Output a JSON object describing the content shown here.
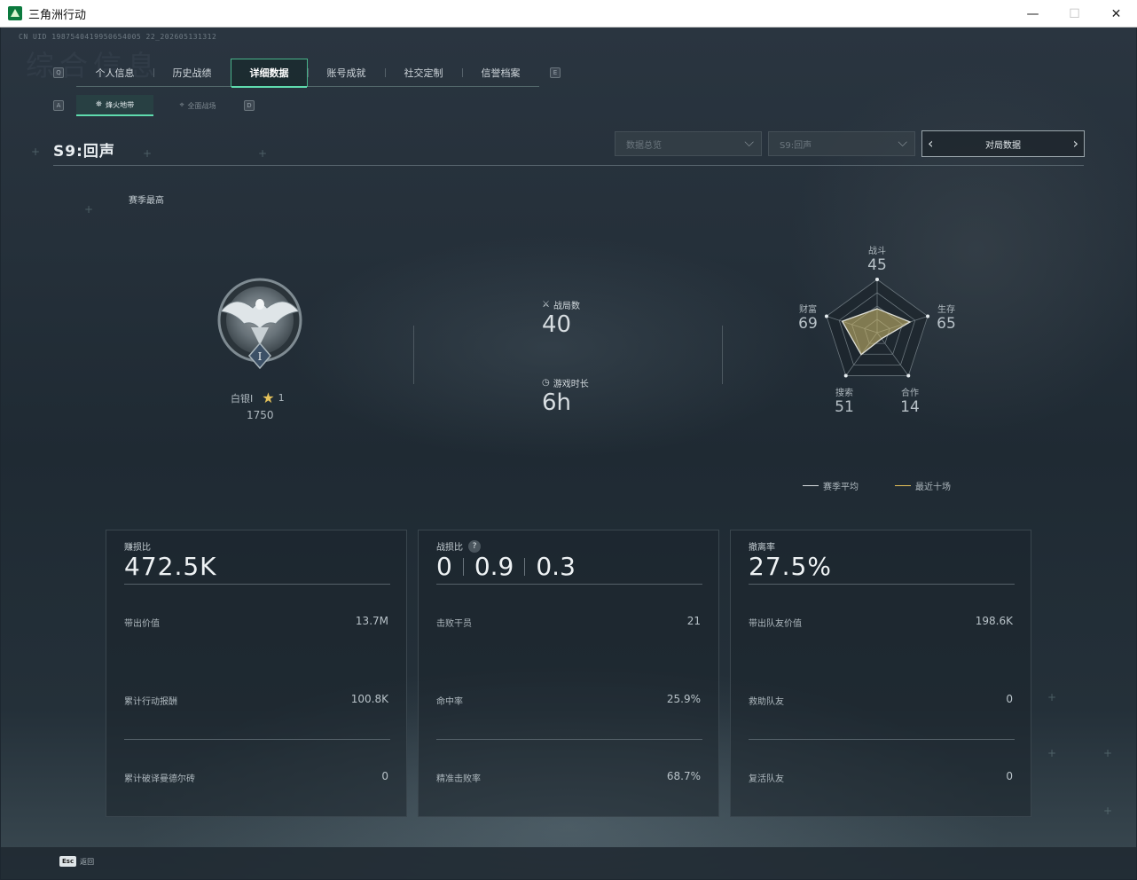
{
  "window": {
    "title": "三角洲行动",
    "minimize": "—",
    "maximize": "☐",
    "close": "✕"
  },
  "uid": "CN UID 1987540419950654005 22_202605131312",
  "watermark": "综合信息",
  "key_hints": {
    "prev_tab": "Q",
    "next_tab": "E",
    "prev_sub": "A",
    "next_sub": "D"
  },
  "main_tabs": [
    {
      "label": "个人信息",
      "active": false
    },
    {
      "label": "历史战绩",
      "active": false
    },
    {
      "label": "详细数据",
      "active": true
    },
    {
      "label": "账号成就",
      "active": false
    },
    {
      "label": "社交定制",
      "active": false
    },
    {
      "label": "信誉档案",
      "active": false
    }
  ],
  "sub_tabs": [
    {
      "label": "烽火地带",
      "icon": "tower-icon",
      "active": true
    },
    {
      "label": "全面战场",
      "icon": "crosshair-icon",
      "active": false
    }
  ],
  "season_title": "S9:回声",
  "filters": {
    "data_type": "数据总览",
    "season": "S9:回声",
    "match_data": "对局数据"
  },
  "season_high": "赛季最高",
  "rank": {
    "name": "白银I",
    "stars": "1",
    "score": "1750",
    "roman": "I"
  },
  "stats": {
    "matches_label": "战局数",
    "matches_value": "40",
    "playtime_label": "游戏时长",
    "playtime_value": "6h"
  },
  "radar": {
    "combat_label": "战斗",
    "combat_value": "45",
    "survival_label": "生存",
    "survival_value": "65",
    "coop_label": "合作",
    "coop_value": "14",
    "search_label": "搜索",
    "search_value": "51",
    "wealth_label": "财富",
    "wealth_value": "69",
    "season_avg": [
      45,
      65,
      14,
      51,
      69
    ],
    "recent_ten": [
      45,
      65,
      14,
      51,
      69
    ]
  },
  "legend": {
    "season_avg": "赛季平均",
    "recent_ten": "最近十场"
  },
  "colors": {
    "accent": "#5fdcae",
    "recent": "#e6c35a",
    "avg": "#d8dde0"
  },
  "cards": {
    "profit": {
      "title": "赚损比",
      "value": "472.5K",
      "rows": [
        {
          "label": "带出价值",
          "value": "13.7M"
        },
        {
          "label": "累计行动报酬",
          "value": "100.8K"
        },
        {
          "label": "累计破译曼德尔砖",
          "value": "0"
        }
      ]
    },
    "combat": {
      "title": "战损比",
      "help": "?",
      "values": [
        "0",
        "0.9",
        "0.3"
      ],
      "rows": [
        {
          "label": "击败干员",
          "value": "21"
        },
        {
          "label": "命中率",
          "value": "25.9%"
        },
        {
          "label": "精准击败率",
          "value": "68.7%"
        }
      ]
    },
    "extract": {
      "title": "撤离率",
      "value": "27.5%",
      "rows": [
        {
          "label": "带出队友价值",
          "value": "198.6K"
        },
        {
          "label": "救助队友",
          "value": "0"
        },
        {
          "label": "复活队友",
          "value": "0"
        }
      ]
    }
  },
  "footer": {
    "esc_key": "Esc",
    "back": "返回"
  }
}
